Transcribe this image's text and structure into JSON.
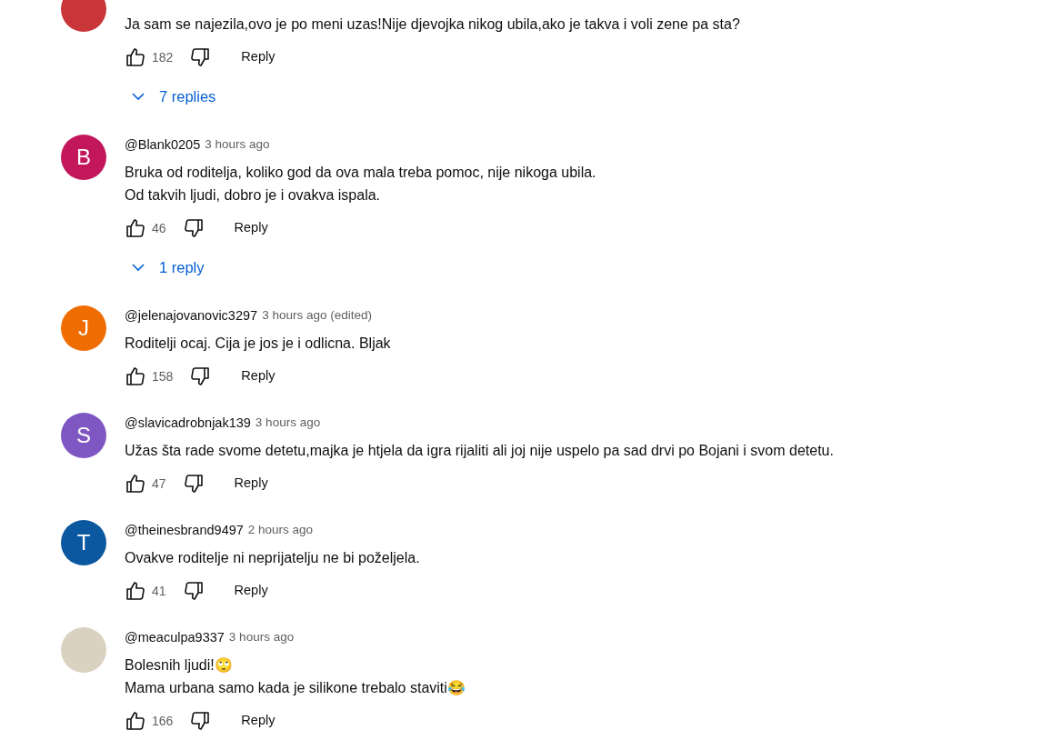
{
  "comments": [
    {
      "avatar": {
        "kind": "photo"
      },
      "text": "Ja sam se najezila,ovo je po meni uzas!Nije djevojka nikog ubila,ako je takva i voli zene pa sta?",
      "likes": "182",
      "reply_label": "Reply",
      "replies": "7 replies"
    },
    {
      "avatar": {
        "kind": "letter",
        "letter": "B",
        "color": "#c2185b"
      },
      "author": "@Blank0205",
      "time": "3 hours ago",
      "text": "Bruka od roditelja, koliko god da ova mala treba pomoc, nije nikoga ubila.\nOd takvih ljudi, dobro je i ovakva ispala.",
      "likes": "46",
      "reply_label": "Reply",
      "replies": "1 reply"
    },
    {
      "avatar": {
        "kind": "letter",
        "letter": "J",
        "color": "#ef6c00"
      },
      "author": "@jelenajovanovic3297",
      "time": "3 hours ago (edited)",
      "text": "Roditelji ocaj. Cija je jos je i odlicna. Bljak",
      "likes": "158",
      "reply_label": "Reply"
    },
    {
      "avatar": {
        "kind": "letter",
        "letter": "S",
        "color": "#7e57c2"
      },
      "author": "@slavicadrobnjak139",
      "time": "3 hours ago",
      "text": "Užas šta rade svome detetu,majka je htjela da igra rijaliti ali joj nije uspelo pa sad drvi po Bojani i svom detetu.",
      "likes": "47",
      "reply_label": "Reply"
    },
    {
      "avatar": {
        "kind": "letter",
        "letter": "T",
        "color": "#0b57a0"
      },
      "author": "@theinesbrand9497",
      "time": "2 hours ago",
      "text": "Ovakve roditelje ni neprijatelju ne bi poželjela.",
      "likes": "41",
      "reply_label": "Reply"
    },
    {
      "avatar": {
        "kind": "photo"
      },
      "author": "@meaculpa9337",
      "time": "3 hours ago",
      "text": "Bolesnih ljudi!🙄\nMama urbana samo kada je silikone trebalo staviti😂",
      "likes": "166",
      "reply_label": "Reply"
    }
  ]
}
